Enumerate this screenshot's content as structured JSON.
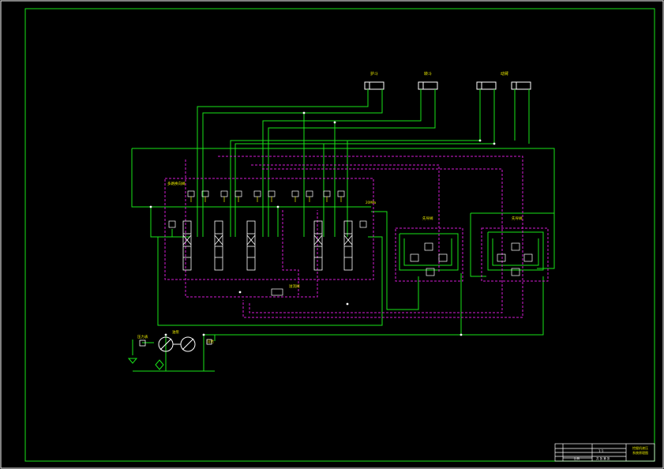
{
  "colors": {
    "background": "#000000",
    "frame": "#ffffff",
    "line": "#19e319",
    "pilot": "#d21bd2",
    "label": "#e8e800",
    "symbol": "#ffffff"
  },
  "labels": {
    "cyl_left": "护斗",
    "cyl_mid": "转斗",
    "cyl_right": "动臂",
    "valve_block": "多路换向阀",
    "aux_valve_1": "先导阀",
    "aux_valve_2": "先导阀",
    "relief": "溢流阀",
    "pressure": "20MPa",
    "pump": "油泵",
    "motor": "马达",
    "gauge": "压力表"
  },
  "title_block": {
    "rows": [
      "挖掘机液压",
      "系统原理图"
    ],
    "cell_a": "1:1",
    "cell_b": "比例",
    "cell_c": "共  张  第  张"
  }
}
